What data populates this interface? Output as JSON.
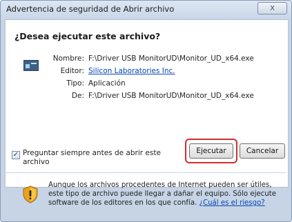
{
  "window": {
    "title": "Advertencia de seguridad de Abrir archivo",
    "close_glyph": "X"
  },
  "question": "¿Desea ejecutar este archivo?",
  "fields": {
    "name_label": "Nombre:",
    "name_value": "F:\\Driver USB MonitorUD\\Monitor_UD_x64.exe",
    "publisher_label": "Editor:",
    "publisher_value": "Silicon Laboratories Inc.",
    "type_label": "Tipo:",
    "type_value": "Aplicación",
    "from_label": "De:",
    "from_value": "F:\\Driver USB MonitorUD\\Monitor_UD_x64.exe"
  },
  "buttons": {
    "run": "Ejecutar",
    "cancel": "Cancelar"
  },
  "checkbox": {
    "line1": "Preguntar siempre antes de abrir este",
    "line2": "archivo",
    "checked": true
  },
  "warning": {
    "text": "Aunque los archivos procedentes de Internet pueden ser útiles, este tipo de archivo puede llegar a dañar el equipo. Sólo ejecute software de los editores en los que confía. ",
    "link": "¿Cuál es el riesgo?"
  },
  "colors": {
    "highlight": "#cf2e2e",
    "link": "#0645b5"
  },
  "icons": {
    "file": "application-icon",
    "warning": "security-shield-icon"
  }
}
